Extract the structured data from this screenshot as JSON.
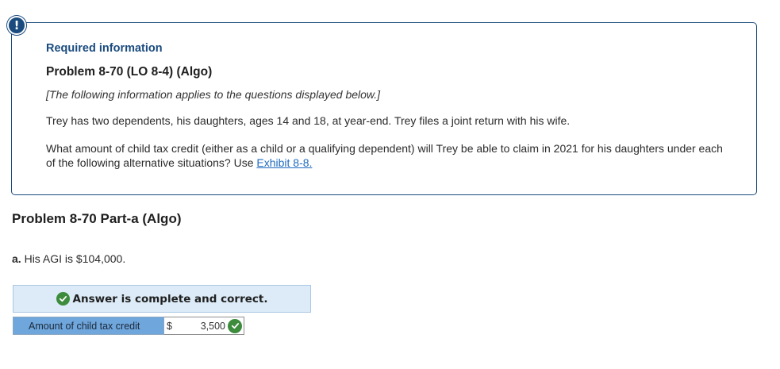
{
  "info": {
    "badge": "!",
    "label": "Required information",
    "problem_title": "Problem 8-70 (LO 8-4) (Algo)",
    "note": "[The following information applies to the questions displayed below.]",
    "paragraph1": "Trey has two dependents, his daughters, ages 14 and 18, at year-end. Trey files a joint return with his wife.",
    "paragraph2_prefix": "What amount of child tax credit (either as a child or a qualifying dependent) will Trey be able to claim in 2021 for his daughters under each of the following alternative situations? Use ",
    "exhibit_link": "Exhibit 8-8."
  },
  "part": {
    "title": "Problem 8-70 Part-a (Algo)"
  },
  "question": {
    "letter": "a.",
    "text": "His AGI is $104,000."
  },
  "answer": {
    "banner": "Answer is complete and correct.",
    "row_label": "Amount of child tax credit",
    "currency": "$",
    "value": "3,500"
  },
  "colors": {
    "accent": "#1a4b7e",
    "link": "#1f6bc0",
    "correct": "#3d8b3d",
    "banner_bg": "#dcebf7",
    "label_bg": "#6fa6dc"
  },
  "icons": {
    "badge": "alert-icon",
    "banner": "check-circle-icon",
    "input_status": "check-circle-icon"
  }
}
